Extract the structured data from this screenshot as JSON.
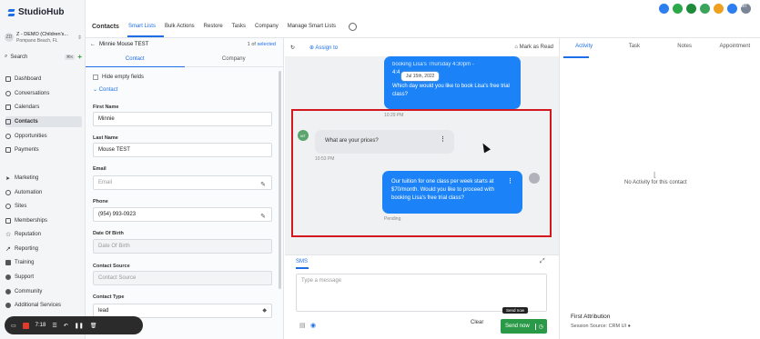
{
  "app": {
    "brand": "StudioHub"
  },
  "sidebar": {
    "location_name": "Z - DEMO (Children's...",
    "location_sub": "Pompano Beach, FL",
    "location_icon": "ZD",
    "search_label": "Search",
    "search_kbd": "⌘K",
    "items": [
      {
        "label": "Dashboard",
        "icon": "dashboard-icon"
      },
      {
        "label": "Conversations",
        "icon": "chat-icon"
      },
      {
        "label": "Calendars",
        "icon": "calendar-icon"
      },
      {
        "label": "Contacts",
        "icon": "contacts-icon",
        "active": true
      },
      {
        "label": "Opportunities",
        "icon": "filter-icon"
      },
      {
        "label": "Payments",
        "icon": "payments-icon"
      },
      {
        "label": "Marketing",
        "icon": "send-icon"
      },
      {
        "label": "Automation",
        "icon": "automation-icon"
      },
      {
        "label": "Sites",
        "icon": "globe-icon"
      },
      {
        "label": "Memberships",
        "icon": "membership-icon"
      },
      {
        "label": "Reputation",
        "icon": "star-icon"
      },
      {
        "label": "Reporting",
        "icon": "chart-icon"
      },
      {
        "label": "Training",
        "icon": "book-icon"
      },
      {
        "label": "Support",
        "icon": "support-icon"
      },
      {
        "label": "Community",
        "icon": "community-icon"
      },
      {
        "label": "Additional Services",
        "icon": "services-icon"
      }
    ]
  },
  "topbar": {
    "title": "Contacts",
    "tabs": [
      "Smart Lists",
      "Bulk Actions",
      "Restore",
      "Tasks",
      "Company",
      "Manage Smart Lists"
    ],
    "avatar_initials": "MT"
  },
  "contact": {
    "name": "Minnie Mouse TEST",
    "pagination": "1 of",
    "selected": "selected",
    "tabs": [
      "Contact",
      "Company"
    ],
    "hide_empty": "Hide empty fields",
    "section": "Contact",
    "fields": {
      "first_name": {
        "label": "First Name",
        "value": "Minnie"
      },
      "last_name": {
        "label": "Last Name",
        "value": "Mouse TEST"
      },
      "email": {
        "label": "Email",
        "placeholder": "Email"
      },
      "phone": {
        "label": "Phone",
        "value": "(954) 993-0923"
      },
      "dob": {
        "label": "Date Of Birth",
        "placeholder": "Date Of Birth"
      },
      "source": {
        "label": "Contact Source",
        "placeholder": "Contact Source"
      },
      "type": {
        "label": "Contact Type",
        "value": "lead"
      }
    }
  },
  "chat": {
    "assign_label": "Assign to",
    "mark_read": "Mark as Read",
    "date_pill": "Jul 15th, 2022",
    "msg_top_partial": "booking Lisa's Thursday 4:30pm -",
    "msg_top_partial2": "4:4",
    "msg_top": "Which day would you like to book Lisa's free trial class?",
    "ts1": "10:29 PM",
    "msg_in": "What are your prices?",
    "ts2": "10:53 PM",
    "in_avatar": "MT",
    "msg_out": "Our tuition for one class per week starts at $70/month. Would you like to proceed with booking Lisa's free trial class?",
    "pending": "Pending",
    "sms_tab": "SMS",
    "placeholder": "Type a message",
    "clear": "Clear",
    "send": "Send now",
    "tooltip": "Send now"
  },
  "right": {
    "tabs": [
      "Activity",
      "Task",
      "Notes",
      "Appointment"
    ],
    "no_activity": "No Activity for this contact",
    "first_attr": "First Attribution",
    "session_source": "Session Source: CRM UI"
  },
  "recorder": {
    "time": "7:18"
  }
}
